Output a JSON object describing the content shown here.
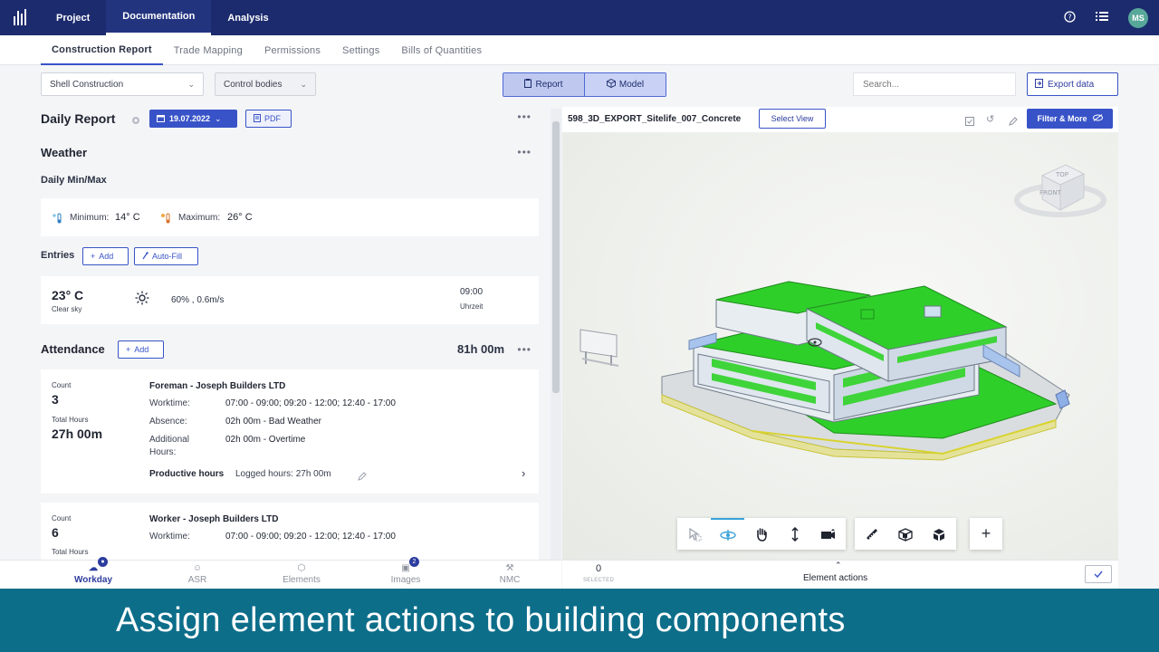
{
  "topnav": {
    "items": [
      "Project",
      "Documentation",
      "Analysis"
    ],
    "avatar": "MS"
  },
  "subtabs": [
    "Construction Report",
    "Trade Mapping",
    "Permissions",
    "Settings",
    "Bills of Quantities"
  ],
  "filters": {
    "section": "Shell Construction",
    "bodies": "Control bodies"
  },
  "view_toggle": {
    "report": "Report",
    "model": "Model"
  },
  "search": {
    "placeholder": "Search..."
  },
  "export_label": "Export data",
  "report": {
    "title": "Daily Report",
    "date": "19.07.2022",
    "pdf": "PDF",
    "weather_title": "Weather",
    "minmax_title": "Daily Min/Max",
    "min_label": "Minimum:",
    "min_value": "14° C",
    "max_label": "Maximum:",
    "max_value": "26° C",
    "entries_title": "Entries",
    "add": "Add",
    "autofill": "Auto-Fill",
    "entry": {
      "temp": "23° C",
      "condition": "Clear sky",
      "humidity_wind": "60% , 0.6m/s",
      "time": "09:00",
      "time_label": "Uhrzeit"
    },
    "attendance_title": "Attendance",
    "attendance_total": "81h 00m",
    "groups": [
      {
        "count_label": "Count",
        "count": "3",
        "hours_label": "Total Hours",
        "hours": "27h 00m",
        "name": "Foreman - Joseph Builders LTD",
        "worktime_label": "Worktime:",
        "worktime": "07:00 - 09:00; 09:20 - 12:00; 12:40 - 17:00",
        "absence_label": "Absence:",
        "absence": "02h 00m - Bad Weather",
        "additional_label_1": "Additional",
        "additional_label_2": "Hours:",
        "additional": "02h 00m - Overtime",
        "productive_label": "Productive hours",
        "logged": "Logged hours: 27h 00m"
      },
      {
        "count_label": "Count",
        "count": "6",
        "hours_label": "Total Hours",
        "name": "Worker - Joseph Builders LTD",
        "worktime_label": "Worktime:",
        "worktime": "07:00 - 09:00; 09:20 - 12:00; 12:40 - 17:00"
      }
    ]
  },
  "bottomnav": [
    {
      "label": "Workday",
      "badge": ""
    },
    {
      "label": "ASR"
    },
    {
      "label": "Elements"
    },
    {
      "label": "Images",
      "badge": "2"
    },
    {
      "label": "NMC"
    }
  ],
  "viewer": {
    "model_name": "598_3D_EXPORT_Sitelife_007_Concrete",
    "select_view": "Select View",
    "filter": "Filter & More",
    "cube_top": "TOP",
    "cube_front": "FRONT",
    "selected_count": "0",
    "selected_label": "SELECTED",
    "element_actions": "Element actions"
  },
  "caption": "Assign element actions to building components",
  "colors": {
    "brand": "#1c2b6e",
    "accent": "#3853c8",
    "model_green": "#2fcf2a",
    "caption_bg": "#0d6e8a"
  }
}
